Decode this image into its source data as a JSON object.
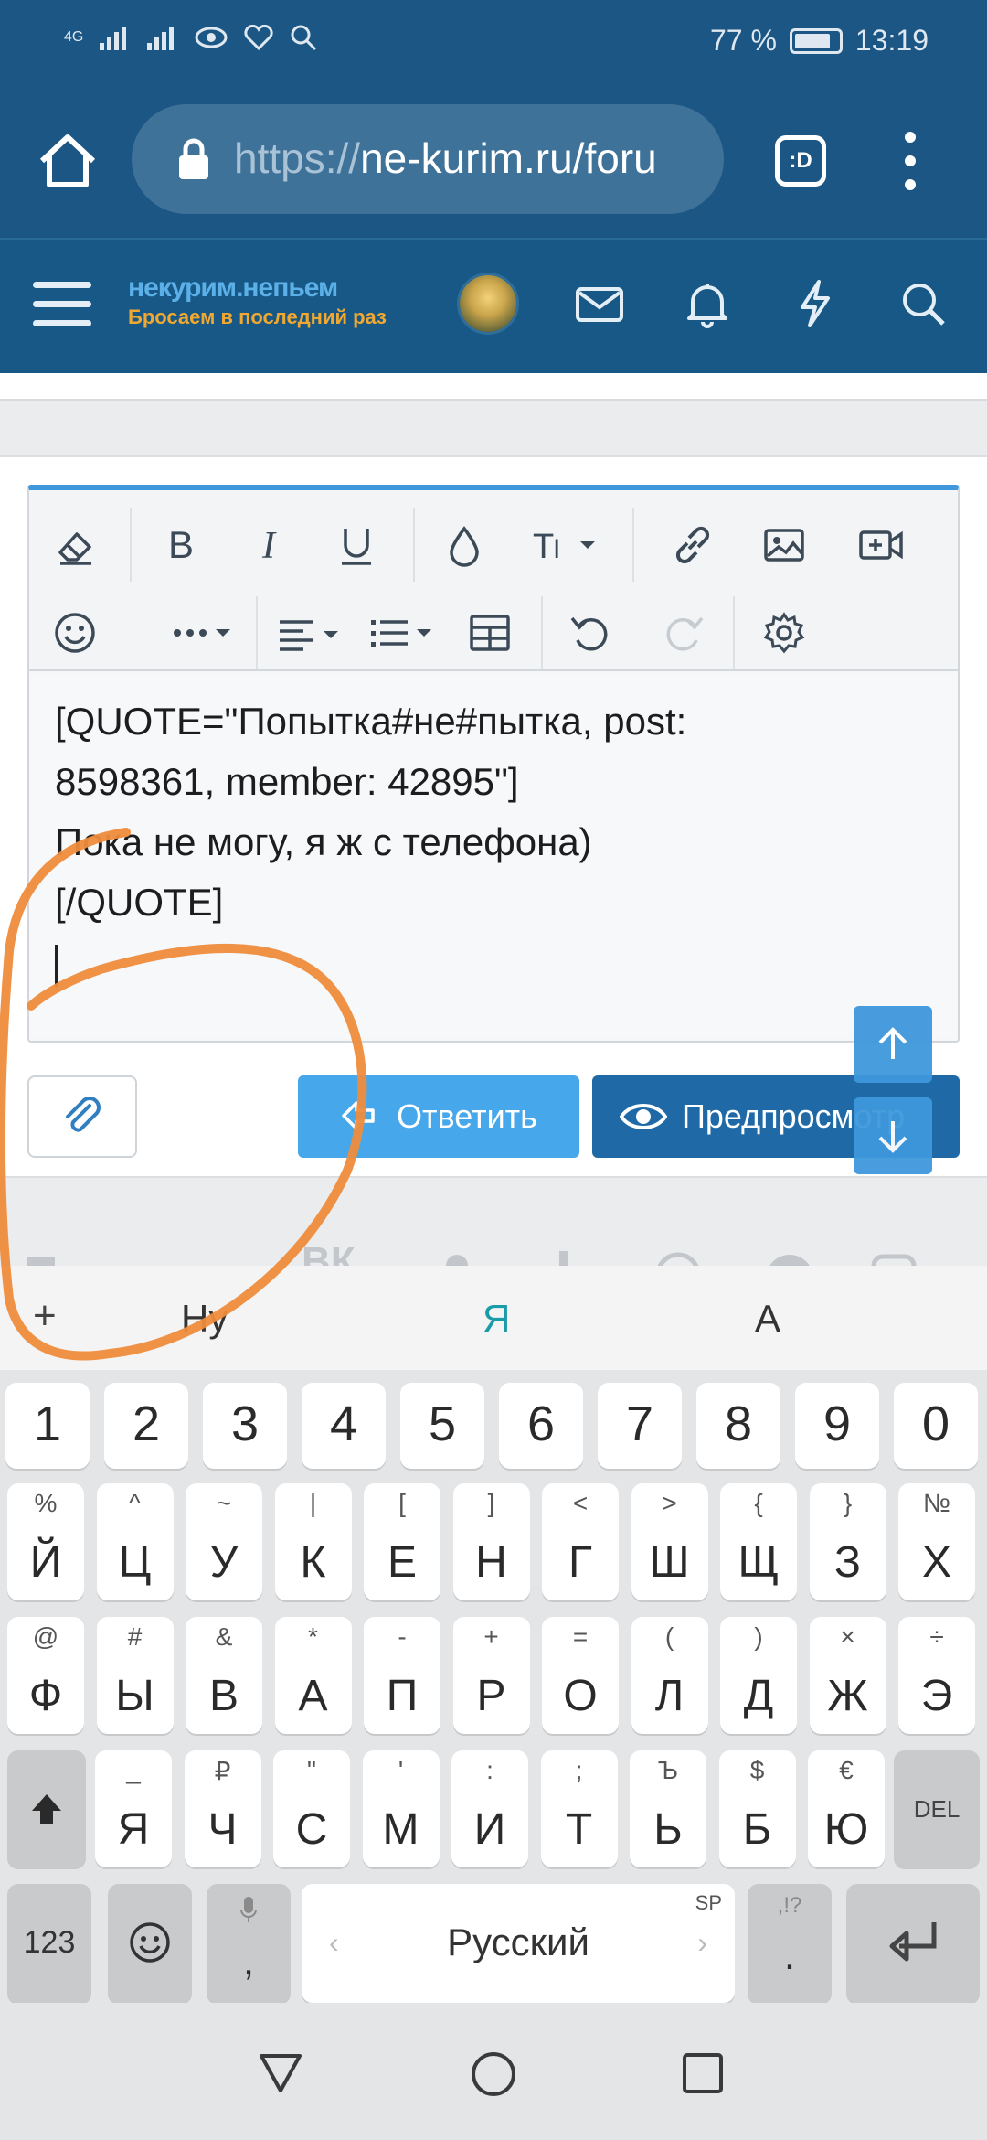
{
  "status_bar": {
    "signal_left": "4G",
    "battery_percent": "77 %",
    "time": "13:19"
  },
  "browser": {
    "url_scheme": "https://",
    "url_host": "ne-kurim.ru/foru",
    "tabs_label": ":D"
  },
  "site": {
    "logo_line1": "некурим.непьем",
    "logo_line2": "Бросаем в последний раз"
  },
  "editor": {
    "lines": [
      "[QUOTE=\"Попытка#не#пытка, post:",
      "8598361, member: 42895\"]",
      "Пока не могу, я ж с телефона)",
      "[/QUOTE]"
    ],
    "reply_label": "Ответить",
    "preview_label": "Предпросмотр"
  },
  "keyboard": {
    "suggestions": [
      "Ну",
      "Я",
      "А"
    ],
    "number_row": [
      "1",
      "2",
      "3",
      "4",
      "5",
      "6",
      "7",
      "8",
      "9",
      "0"
    ],
    "row1": [
      {
        "sup": "%",
        "main": "Й"
      },
      {
        "sup": "^",
        "main": "Ц"
      },
      {
        "sup": "~",
        "main": "У"
      },
      {
        "sup": "|",
        "main": "К"
      },
      {
        "sup": "[",
        "main": "Е"
      },
      {
        "sup": "]",
        "main": "Н"
      },
      {
        "sup": "<",
        "main": "Г"
      },
      {
        "sup": ">",
        "main": "Ш"
      },
      {
        "sup": "{",
        "main": "Щ"
      },
      {
        "sup": "}",
        "main": "З"
      },
      {
        "sup": "№",
        "main": "Х"
      }
    ],
    "row2": [
      {
        "sup": "@",
        "main": "Ф"
      },
      {
        "sup": "#",
        "main": "Ы"
      },
      {
        "sup": "&",
        "main": "В"
      },
      {
        "sup": "*",
        "main": "А"
      },
      {
        "sup": "-",
        "main": "П"
      },
      {
        "sup": "+",
        "main": "Р"
      },
      {
        "sup": "=",
        "main": "О"
      },
      {
        "sup": "(",
        "main": "Л"
      },
      {
        "sup": ")",
        "main": "Д"
      },
      {
        "sup": "×",
        "main": "Ж"
      },
      {
        "sup": "÷",
        "main": "Э"
      }
    ],
    "row3": [
      {
        "sup": "_",
        "main": "Я"
      },
      {
        "sup": "₽",
        "main": "Ч"
      },
      {
        "sup": "\"",
        "main": "С"
      },
      {
        "sup": "'",
        "main": "М"
      },
      {
        "sup": ":",
        "main": "И"
      },
      {
        "sup": ";",
        "main": "Т"
      },
      {
        "sup": "Ъ",
        "main": "Ь"
      },
      {
        "sup": "$",
        "main": "Б"
      },
      {
        "sup": "€",
        "main": "Ю"
      }
    ],
    "del_label": "DEL",
    "num_label": "123",
    "space_label": "Русский",
    "space_sup": "SP",
    "comma": ",",
    "period": ".",
    "period_sup": ",!?"
  }
}
